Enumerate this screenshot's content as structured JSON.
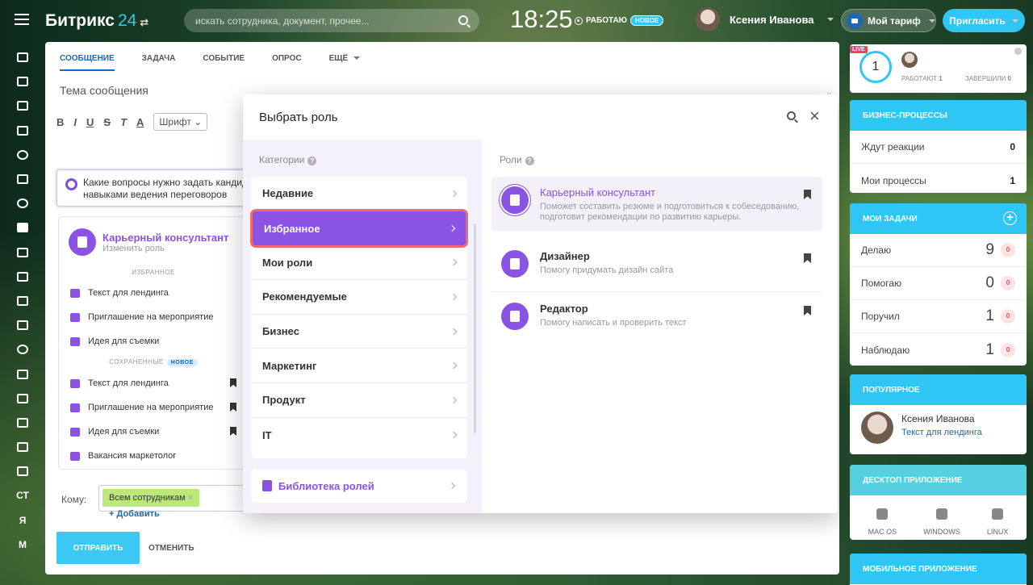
{
  "header": {
    "logo": "Битрикс",
    "logo_num": "24",
    "logo_sym": "⇄",
    "search_placeholder": "искать сотрудника, документ, прочее...",
    "clock": "18:25",
    "work_status": "РАБОТАЮ",
    "work_badge": "НОВОЕ",
    "user_name": "Ксения Иванова",
    "tariff": "Мой тариф",
    "invite": "Пригласить"
  },
  "left_nav": [
    "home",
    "tasks",
    "feed",
    "bank",
    "crm",
    "shop",
    "sites",
    "chat",
    "calendar",
    "docs",
    "drive",
    "mail",
    "team",
    "contacts",
    "robots",
    "store",
    "marta",
    "dev",
    "СТ",
    "Я",
    "М"
  ],
  "composer": {
    "tabs": [
      "СООБЩЕНИЕ",
      "ЗАДАЧА",
      "СОБЫТИЕ",
      "ОПРОС",
      "ЕЩЁ"
    ],
    "subject_placeholder": "Тема сообщения",
    "font_select": "Шрифт",
    "ai_prompt": "Какие вопросы нужно задать кандидату с навыками ведения переговоров",
    "role_name": "Карьерный консультант",
    "role_change": "Изменить роль",
    "sec_fav": "ИЗБРАННОЕ",
    "sec_saved": "СОХРАНЕННЫЕ",
    "sec_saved_badge": "НОВОЕ",
    "fav": [
      "Текст для лендинга",
      "Приглашение на мероприятие",
      "Идея для съемки"
    ],
    "saved": [
      "Текст для лендинга",
      "Приглашение на мероприятие",
      "Идея для съемки",
      "Вакансия маркетолог"
    ],
    "to_label": "Кому:",
    "to_chip": "Всем сотрудникам",
    "to_add": "+ Добавить",
    "send": "ОТПРАВИТЬ",
    "cancel": "ОТМЕНИТЬ"
  },
  "dialog": {
    "title": "Выбрать роль",
    "categories_label": "Категории",
    "roles_label": "Роли",
    "categories": [
      "Недавние",
      "Избранное",
      "Мои роли",
      "Рекомендуемые",
      "Бизнес",
      "Маркетинг",
      "Продукт",
      "IT"
    ],
    "active_category": "Избранное",
    "library": "Библиотека ролей",
    "roles": [
      {
        "name": "Карьерный консультант",
        "desc": "Поможет составить резюме и подготовиться к собеседованию, подготовит рекомендации по развитию карьеры."
      },
      {
        "name": "Дизайнер",
        "desc": "Помогу придумать дизайн сайта"
      },
      {
        "name": "Редактор",
        "desc": "Помогу написать и проверить текст"
      }
    ]
  },
  "right": {
    "live": "LIVE",
    "count": "1",
    "working": "РАБОТАЮТ",
    "working_n": "1",
    "done": "ЗАВЕРШИЛИ",
    "done_n": "0",
    "bp_title": "БИЗНЕС-ПРОЦЕССЫ",
    "bp": [
      {
        "label": "Ждут реакции",
        "v": "0"
      },
      {
        "label": "Мои процессы",
        "v": "1"
      }
    ],
    "tasks_title": "МОИ ЗАДАЧИ",
    "tasks": [
      {
        "label": "Делаю",
        "v": "9",
        "z": "0"
      },
      {
        "label": "Помогаю",
        "v": "0",
        "z": "0"
      },
      {
        "label": "Поручил",
        "v": "1",
        "z": "0"
      },
      {
        "label": "Наблюдаю",
        "v": "1",
        "z": "0"
      }
    ],
    "pop_title": "ПОПУЛЯРНОЕ",
    "pop_name": "Ксения Иванова",
    "pop_link": "Текст для лендинга",
    "desk_title": "ДЕСКТОП ПРИЛОЖЕНИЕ",
    "desk": [
      "MAC OS",
      "WINDOWS",
      "LINUX"
    ],
    "mob_title": "МОБИЛЬНОЕ ПРИЛОЖЕНИЕ"
  },
  "colors": {
    "accent": "#8a53e3",
    "blue": "#2fc6f6",
    "link": "#2067b0"
  }
}
